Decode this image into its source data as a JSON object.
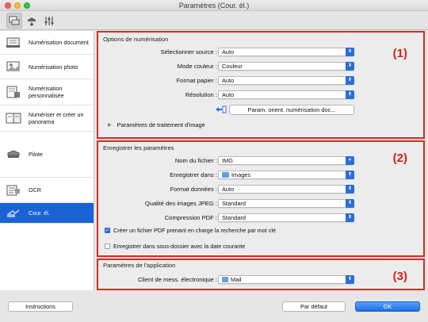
{
  "window": {
    "title": "Paramètres (Cour. él.)"
  },
  "toolbar": {
    "icons": [
      "scan-from-computer-icon",
      "scan-from-panel-icon",
      "general-settings-icon"
    ]
  },
  "sidebar": {
    "items": [
      {
        "label": "Numérisation document"
      },
      {
        "label": "Numérisation photo"
      },
      {
        "label": "Numérisation personnalisée"
      },
      {
        "label": "Numériser et créer un panorama"
      },
      {
        "label": "Pilote"
      },
      {
        "label": "OCR"
      },
      {
        "label": "Cour. él."
      }
    ]
  },
  "scan_options": {
    "title": "Options de numérisation",
    "number": "(1)",
    "select_source_label": "Sélectionner source :",
    "select_source_value": "Auto",
    "color_mode_label": "Mode couleur :",
    "color_mode_value": "Couleur",
    "paper_size_label": "Format papier :",
    "paper_size_value": "Auto",
    "resolution_label": "Résolution :",
    "resolution_value": "Auto",
    "orientation_button": "Param. orient. numérisation doc...",
    "image_processing": "Paramètres de traitement d'image"
  },
  "save_settings": {
    "title": "Enregistrer les paramètres",
    "number": "(2)",
    "filename_label": "Nom du fichier :",
    "filename_value": "IMG",
    "save_in_label": "Enregistrer dans :",
    "save_in_value": "Images",
    "data_format_label": "Format données :",
    "data_format_value": "Auto",
    "jpeg_quality_label": "Qualité des images JPEG :",
    "jpeg_quality_value": "Standard",
    "pdf_compression_label": "Compression PDF :",
    "pdf_compression_value": "Standard",
    "searchable_pdf_label": "Créer un fichier PDF prenant en charge la recherche par mot clé",
    "searchable_pdf_checked": true,
    "subfolder_label": "Enregistrer dans sous-dossier avec la date courante",
    "subfolder_checked": false
  },
  "app_settings": {
    "title": "Paramètres de l'application",
    "number": "(3)",
    "email_client_label": "Client de mess. électronique :",
    "email_client_value": "Mail"
  },
  "footer": {
    "instructions": "Instructions",
    "defaults": "Par défaut",
    "ok": "OK"
  },
  "colors": {
    "accent": "#1a63d6",
    "highlight_border": "#e0281e"
  }
}
